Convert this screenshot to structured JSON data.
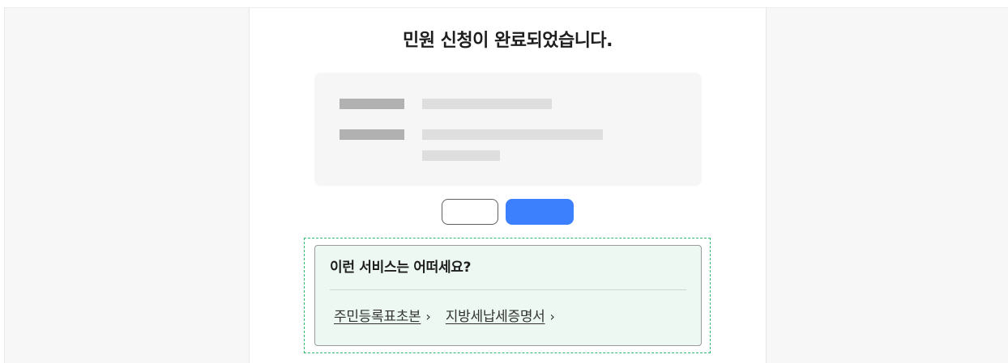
{
  "page": {
    "title": "민원 신청이 완료되었습니다."
  },
  "info_card": {
    "rows": [
      {
        "label": "",
        "value": ""
      },
      {
        "label": "",
        "value": ""
      }
    ]
  },
  "actions": {
    "secondary_label": "",
    "primary_label": ""
  },
  "recommendation": {
    "heading": "이런 서비스는 어떠세요?",
    "links": [
      {
        "label": "주민등록표초본",
        "chevron": "›"
      },
      {
        "label": "지방세납세증명서",
        "chevron": "›"
      }
    ]
  },
  "colors": {
    "primary": "#3d80fe",
    "highlight_border": "#2dbb6e",
    "highlight_bg": "#ecf8f1",
    "placeholder_label": "#b1b1b1",
    "placeholder_value": "#dedede"
  },
  "icons": {
    "link_chevron": "chevron-right-icon"
  }
}
